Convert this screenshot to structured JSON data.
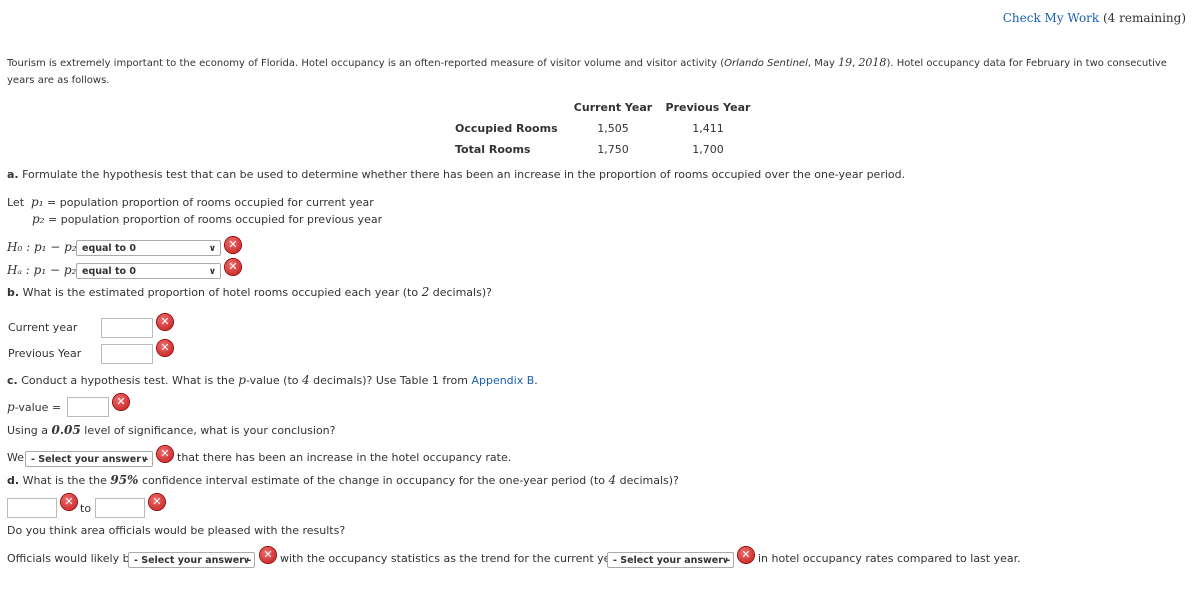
{
  "header": {
    "check_my_work": "Check My Work",
    "remaining": "(4 remaining)"
  },
  "intro": {
    "line1a": "Tourism is extremely important to the economy of Florida. Hotel occupancy is an often-reported measure of visitor volume and visitor activity (",
    "source": "Orlando Sentinel",
    "line1b": ", May ",
    "day": "19",
    "line1c": ", ",
    "year": "2018",
    "line1d": "). Hotel occupancy data for February in two consecutive years",
    "line2": "are as follows."
  },
  "table": {
    "headers": [
      "Current Year",
      "Previous Year"
    ],
    "rows": [
      {
        "label": "Occupied Rooms",
        "values": [
          "1,505",
          "1,411"
        ]
      },
      {
        "label": "Total Rooms",
        "values": [
          "1,750",
          "1,700"
        ]
      }
    ]
  },
  "part_a": {
    "label": "a.",
    "text": "Formulate the hypothesis test that can be used to determine whether there has been an increase in the proportion of rooms occupied over the one-year period.",
    "let": "Let",
    "p1": "p₁",
    "p2": "p₂",
    "eq": "=",
    "p1_def": "population proportion of rooms occupied for current year",
    "p2_def": "population proportion of rooms occupied for previous year",
    "h0": "H₀ : p₁ − p₂",
    "ha": "Hₐ : p₁ − p₂",
    "h0_value": "equal to 0",
    "ha_value": "equal to 0"
  },
  "part_b": {
    "label": "b.",
    "text": "What is the estimated proportion of hotel rooms occupied each year (to ",
    "decimals": "2",
    "text_end": " decimals)?",
    "current_label": "Current year",
    "previous_label": "Previous Year",
    "current_value": "",
    "previous_value": ""
  },
  "part_c": {
    "label": "c.",
    "text": "Conduct a hypothesis test. What is the ",
    "pv": "p",
    "text2": "-value (to ",
    "decimals": "4",
    "text3": " decimals)? Use Table 1 from ",
    "link": "Appendix B",
    "text4": ".",
    "pvalue_label": "p",
    "pvalue_label2": "-value =",
    "sig_text": "Using a ",
    "alpha": "0.05",
    "sig_text2": " level of significance, what is your conclusion?",
    "we": "We",
    "select": "- Select your answer -",
    "we_rest": "that there has been an increase in the hotel occupancy rate."
  },
  "part_d": {
    "label": "d.",
    "text": "What is the the ",
    "pct": "95%",
    "text2": " confidence interval estimate of the change in occupancy for the one-year period (to ",
    "decimals": "4",
    "text3": " decimals)?",
    "to": "to",
    "pleased_q": "Do you think area officials would be pleased with the results?",
    "officials": "Officials would likely be",
    "select1": "- Select your answer -",
    "mid": "with the occupancy statistics as the trend for the current year is",
    "select2": "- Select your answer -",
    "end": "in hotel occupancy rates compared to last year."
  },
  "icons": {
    "error": "error-x-icon",
    "dropdown": "chevron-down-icon"
  },
  "colors": {
    "link": "#1a5fb4",
    "error": "#c01818"
  }
}
